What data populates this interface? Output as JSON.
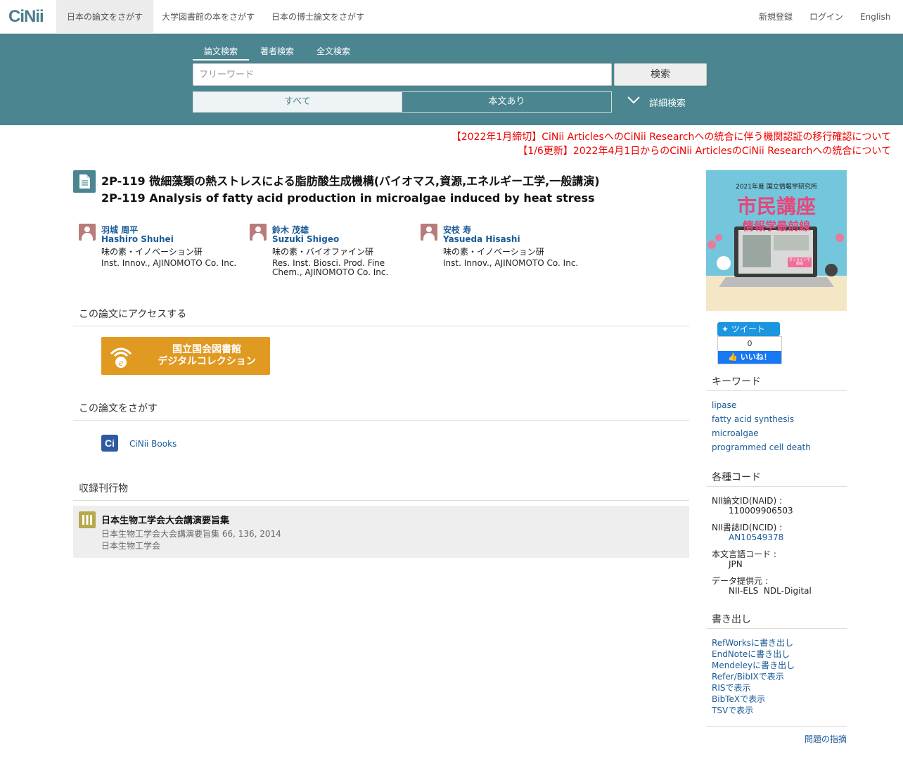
{
  "logo": "CiNii",
  "nav": {
    "tabs": [
      "日本の論文をさがす",
      "大学図書館の本をさがす",
      "日本の博士論文をさがす"
    ],
    "right": [
      "新規登録",
      "ログイン",
      "English"
    ]
  },
  "search": {
    "tabs": [
      "論文検索",
      "著者検索",
      "全文検索"
    ],
    "placeholder": "フリーワード",
    "button": "検索",
    "filter_all": "すべて",
    "filter_body": "本文あり",
    "advanced": "詳細検索"
  },
  "notices": [
    "【2022年1月締切】CiNii ArticlesへのCiNii Researchへの統合に伴う機関認証の移行確認について",
    "【1/6更新】2022年4月1日からのCiNii ArticlesのCiNii Researchへの統合について"
  ],
  "article": {
    "title_ja": "2P-119 微細藻類の熱ストレスによる脂肪酸生成機構(バイオマス,資源,エネルギー工学,一般講演)",
    "title_en": "2P-119 Analysis of fatty acid production in microalgae induced by heat stress",
    "authors": [
      {
        "name_ja": "羽城 周平",
        "name_en": "Hashiro Shuhei",
        "aff_ja": "味の素・イノベーション研",
        "aff_en": "Inst. Innov., AJINOMOTO Co. Inc."
      },
      {
        "name_ja": "鈴木 茂雄",
        "name_en": "Suzuki Shigeo",
        "aff_ja": "味の素・バイオファイン研",
        "aff_en": "Res. Inst. Biosci. Prod. Fine Chem., AJINOMOTO Co. Inc."
      },
      {
        "name_ja": "安枝 寿",
        "name_en": "Yasueda Hisashi",
        "aff_ja": "味の素・イノベーション研",
        "aff_en": "Inst. Innov., AJINOMOTO Co. Inc."
      }
    ]
  },
  "access": {
    "heading": "この論文にアクセスする",
    "ndl_line1": "国立国会図書館",
    "ndl_line2": "デジタルコレクション"
  },
  "find": {
    "heading": "この論文をさがす",
    "cinii_books": "CiNii Books"
  },
  "journal": {
    "heading": "収録刊行物",
    "title": "日本生物工学会大会講演要旨集",
    "detail": "日本生物工学会大会講演要旨集 66, 136, 2014",
    "publisher": "日本生物工学会"
  },
  "banner": {
    "top": "2021年度 国立情報学研究所",
    "title1": "市民講座",
    "title2": "情報学最前線",
    "tag": "オンラインで開催"
  },
  "social": {
    "tweet": "ツイート",
    "fb_count": "0",
    "fb_like": "いいね！"
  },
  "keywords": {
    "heading": "キーワード",
    "items": [
      "lipase",
      "fatty acid synthesis",
      "microalgae",
      "programmed cell death"
    ]
  },
  "codes": {
    "heading": "各種コード",
    "naid_label": "NII論文ID(NAID) :",
    "naid": "110009906503",
    "ncid_label": "NII書誌ID(NCID) :",
    "ncid": "AN10549378",
    "lang_label": "本文言語コード :",
    "lang": "JPN",
    "provider_label": "データ提供元 :",
    "provider": "NII-ELS  NDL-Digital"
  },
  "export": {
    "heading": "書き出し",
    "items": [
      "RefWorksに書き出し",
      "EndNoteに書き出し",
      "Mendeleyに書き出し",
      "Refer/BibIXで表示",
      "RISで表示",
      "BibTeXで表示",
      "TSVで表示"
    ]
  },
  "report": "問題の指摘",
  "colors": {
    "band": "#4a8590",
    "link": "#1a5a96",
    "notice": "#ee0000",
    "ndl": "#e09a22"
  }
}
